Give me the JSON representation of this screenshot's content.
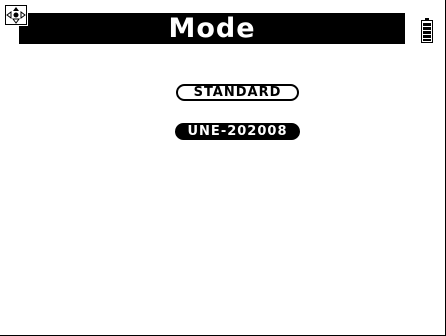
{
  "header": {
    "title": "Mode",
    "nav_icon": "four-way-navigation-icon",
    "battery_icon": "battery-icon"
  },
  "options": [
    {
      "label": "STANDARD",
      "selected": false
    },
    {
      "label": "UNE-202008",
      "selected": true
    }
  ],
  "colors": {
    "background": "#ffffff",
    "foreground": "#000000",
    "highlight_text": "#ffffff"
  }
}
